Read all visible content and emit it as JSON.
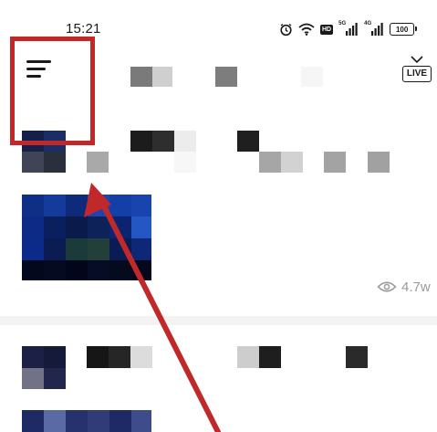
{
  "status_bar": {
    "time": "15:21",
    "icons": [
      "alarm-icon",
      "wifi-icon",
      "hd-icon",
      "signal-5g-icon",
      "signal-4g-icon",
      "battery-icon"
    ],
    "hd_label": "HD",
    "net1_label": "5G",
    "net2_label": "4G",
    "battery_level": "100"
  },
  "header": {
    "menu_icon": "hamburger-menu-icon",
    "live_label": "LIVE"
  },
  "feed": {
    "item1": {
      "view_count": "4.7w"
    }
  },
  "colors": {
    "annotation_red": "#c0282a",
    "background": "#ffffff",
    "divider": "#f3f3f3",
    "muted_text": "#9a9a9a"
  }
}
